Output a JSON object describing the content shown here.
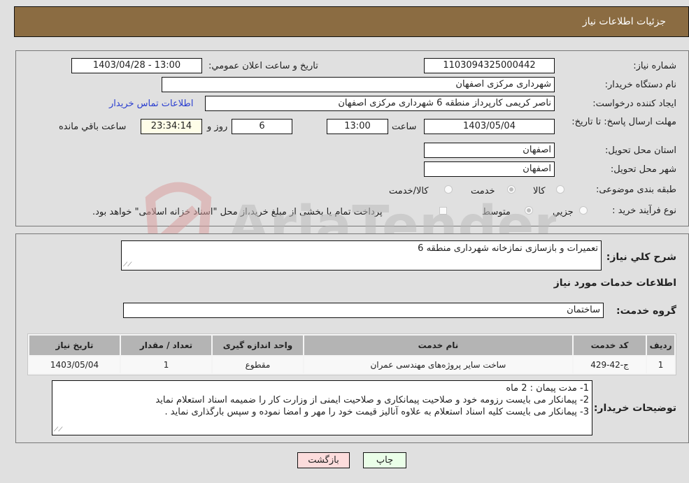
{
  "header": {
    "title": "جزئیات اطلاعات نیاز"
  },
  "fields": {
    "need_number": {
      "label": "شماره نیاز:",
      "value": "1103094325000442"
    },
    "announce_datetime": {
      "label": "تاریخ و ساعت اعلان عمومي:",
      "value": "1403/04/28 - 13:00"
    },
    "buyer_org": {
      "label": "نام دستگاه خريدار:",
      "value": "شهرداری مرکزی اصفهان"
    },
    "requester": {
      "label": "ايجاد کننده درخواست:",
      "value": "ناصر کریمی کارپرداز منطقه 6 شهرداری مرکزی اصفهان"
    },
    "buyer_contact_link": "اطلاعات تماس خريدار",
    "deadline": {
      "label": "مهلت ارسال پاسخ: تا تاريخ:",
      "date": "1403/05/04",
      "time_label": "ساعت",
      "time": "13:00",
      "days": "6",
      "days_label": "روز و",
      "remaining": "23:34:14",
      "remaining_label": "ساعت باقي مانده"
    },
    "province": {
      "label": "استان محل تحويل:",
      "value": "اصفهان"
    },
    "city": {
      "label": "شهر محل تحويل:",
      "value": "اصفهان"
    },
    "category": {
      "label": "طبقه بندی موضوعی:",
      "options": [
        {
          "label": "کالا",
          "checked": false
        },
        {
          "label": "خدمت",
          "checked": true
        },
        {
          "label": "کالا/خدمت",
          "checked": false
        }
      ]
    },
    "purchase_process": {
      "label": "نوع فرآيند خريد :",
      "options": [
        {
          "label": "جزيي",
          "checked": false
        },
        {
          "label": "متوسط",
          "checked": true
        }
      ],
      "treasury_note": "پرداخت تمام يا بخشی از مبلغ خريد،از محل \"اسناد خزانه اسلامی\" خواهد بود."
    }
  },
  "description": {
    "label": "شرح کلي نياز:",
    "value": "تعمیرات و بازسازی نمازخانه شهرداری منطقه 6"
  },
  "services_section_title": "اطلاعات خدمات مورد نياز",
  "service_group": {
    "label": "گروه خدمت:",
    "value": "ساختمان"
  },
  "services_table": {
    "headers": [
      "رديف",
      "کد خدمت",
      "نام خدمت",
      "واحد اندازه گيری",
      "تعداد / مقدار",
      "تاريخ نياز"
    ],
    "rows": [
      [
        "1",
        "ج-42-429",
        "ساخت سایر پروژه‌های مهندسی عمران",
        "مقطوع",
        "1",
        "1403/05/04"
      ]
    ]
  },
  "buyer_notes": {
    "label": "توضيحات خريدار:",
    "lines": [
      "1- مدت پیمان : 2 ماه",
      "2- پیمانکار می بایست رزومه خود و صلاحیت پیمانکاری و صلاحیت ایمنی از وزارت کار را ضمیمه اسناد استعلام نماید",
      "3- پیمانکار می بایست کلیه اسناد استعلام به علاوه آنالیز قیمت خود را مهر و امضا نموده و سپس بارگذاری نماید ."
    ]
  },
  "buttons": {
    "print": "چاپ",
    "back": "بازگشت"
  },
  "watermark": "AriaTender.net",
  "colors": {
    "header_bg": "#8b6c42",
    "link": "#2a3ed0",
    "back_btn": "#fcdcdc",
    "print_btn": "#eafee8",
    "remaining_bg": "#fefde8"
  }
}
